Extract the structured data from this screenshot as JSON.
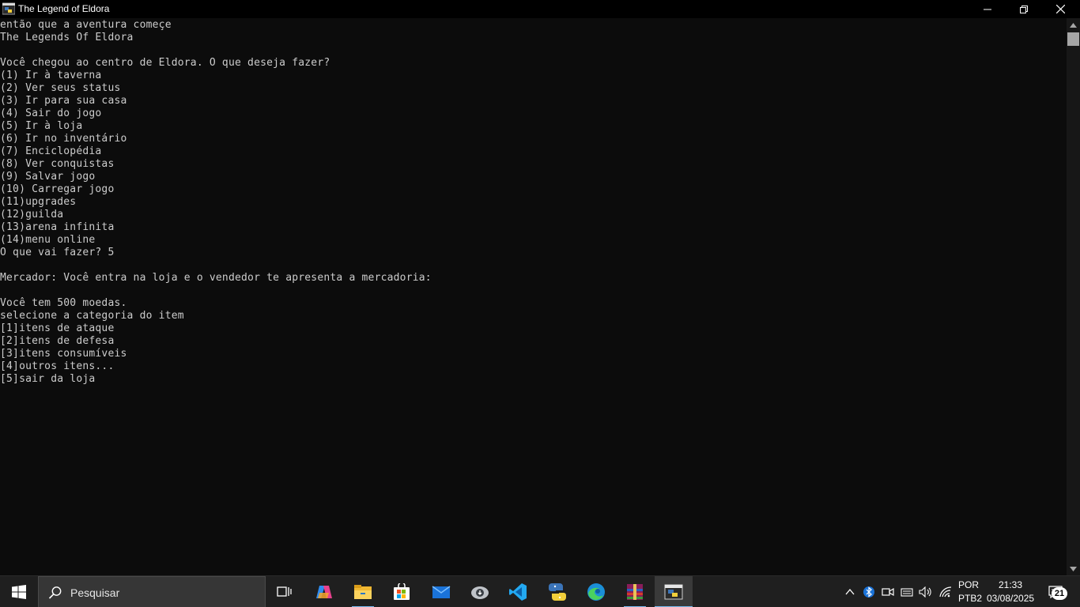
{
  "window": {
    "title": "The Legend of Eldora",
    "app_icon": "console-python-icon",
    "controls": [
      "minimize-icon",
      "restore-icon",
      "close-icon"
    ]
  },
  "console": {
    "lines": [
      "então que a aventura começe",
      "The Legends Of Eldora",
      "",
      "Você chegou ao centro de Eldora. O que deseja fazer?",
      "(1) Ir à taverna",
      "(2) Ver seus status",
      "(3) Ir para sua casa",
      "(4) Sair do jogo",
      "(5) Ir à loja",
      "(6) Ir no inventário",
      "(7) Enciclopédia",
      "(8) Ver conquistas",
      "(9) Salvar jogo",
      "(10) Carregar jogo",
      "(11)upgrades",
      "(12)guilda",
      "(13)arena infinita",
      "(14)menu online",
      "O que vai fazer? 5",
      "",
      "Mercador: Você entra na loja e o vendedor te apresenta a mercadoria:",
      "",
      "Você tem 500 moedas.",
      "selecione a categoria do item",
      "[1]itens de ataque",
      "[2]itens de defesa",
      "[3]itens consumíveis",
      "[4]outros itens...",
      "[5]sair da loja"
    ],
    "text_color": "#cccccc",
    "background": "#0c0c0c"
  },
  "taskbar": {
    "search_placeholder": "Pesquisar",
    "apps": [
      "task-view-icon",
      "copilot-icon",
      "file-explorer-icon",
      "microsoft-store-icon",
      "mail-icon",
      "cloud-backup-icon",
      "vscode-icon",
      "python-icon",
      "edge-icon",
      "winrar-icon",
      "python-console-icon"
    ],
    "tray": {
      "language_top": "POR",
      "language_bottom": "PTB2",
      "time": "21:33",
      "date": "03/08/2025",
      "notification_count": "21"
    },
    "accent": "#76b9ed"
  }
}
